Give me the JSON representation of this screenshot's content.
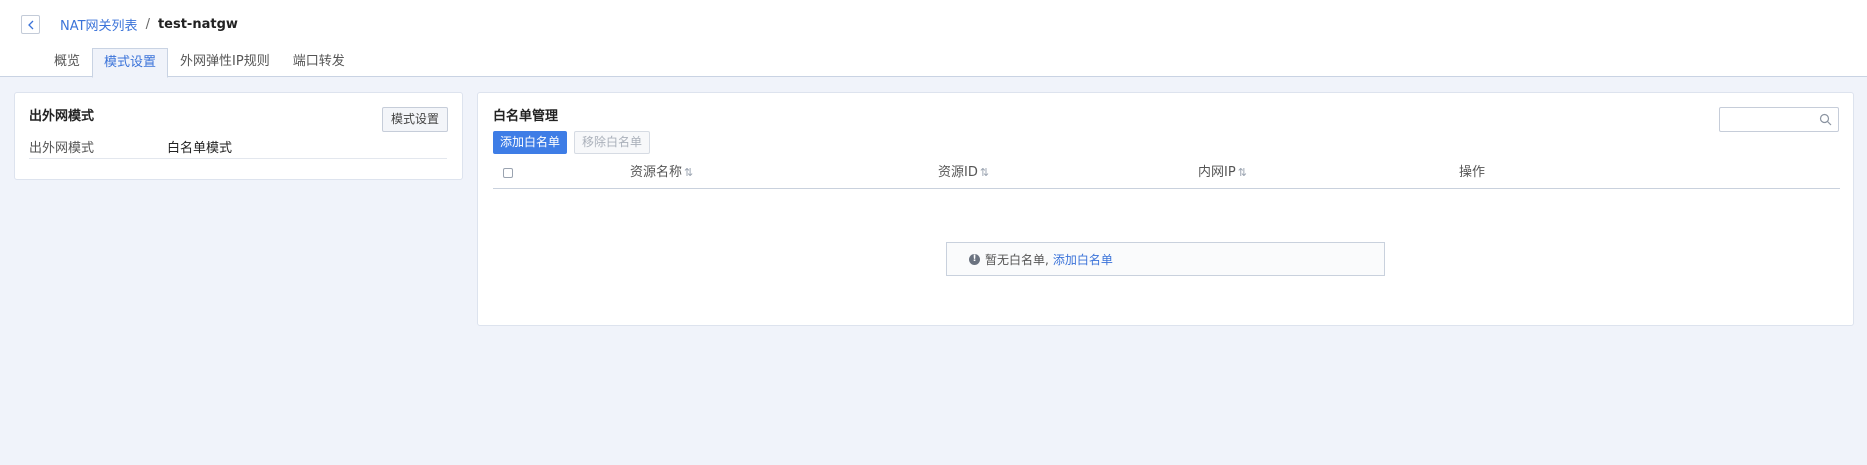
{
  "breadcrumb": {
    "parent": "NAT网关列表",
    "separator": "/",
    "current": "test-natgw"
  },
  "tabs": [
    {
      "label": "概览"
    },
    {
      "label": "模式设置"
    },
    {
      "label": "外网弹性IP规则"
    },
    {
      "label": "端口转发"
    }
  ],
  "left_panel": {
    "title": "出外网模式",
    "button": "模式设置",
    "row_label": "出外网模式",
    "row_value": "白名单模式"
  },
  "right_panel": {
    "title": "白名单管理",
    "add_button": "添加白名单",
    "remove_button": "移除白名单",
    "search_placeholder": "",
    "columns": [
      {
        "label": "资源名称",
        "sortable": true
      },
      {
        "label": "资源ID",
        "sortable": true
      },
      {
        "label": "内网IP",
        "sortable": true
      },
      {
        "label": "操作",
        "sortable": false
      }
    ],
    "sort_glyph": "⇅",
    "empty_text": "暂无白名单,",
    "empty_link": "添加白名单"
  },
  "colors": {
    "accent": "#3b73d9",
    "primary_button": "#3e7de6",
    "background": "#f0f3fa"
  }
}
